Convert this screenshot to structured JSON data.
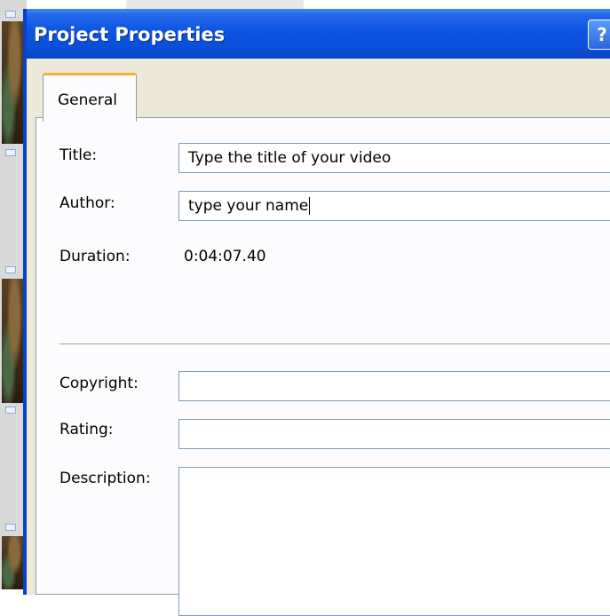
{
  "dialog": {
    "title": "Project Properties",
    "help_label": "?",
    "tab_label": "General"
  },
  "form": {
    "title_label": "Title:",
    "title_value": "Type the title of your video",
    "author_label": "Author:",
    "author_value": "type your name",
    "duration_label": "Duration:",
    "duration_value": "0:04:07.40",
    "copyright_label": "Copyright:",
    "copyright_value": "",
    "rating_label": "Rating:",
    "rating_value": "",
    "description_label": "Description:",
    "description_value": ""
  },
  "colors": {
    "titlebar": "#0a54e3",
    "tab_accent": "#f7b033",
    "field_border": "#7f9db9"
  }
}
